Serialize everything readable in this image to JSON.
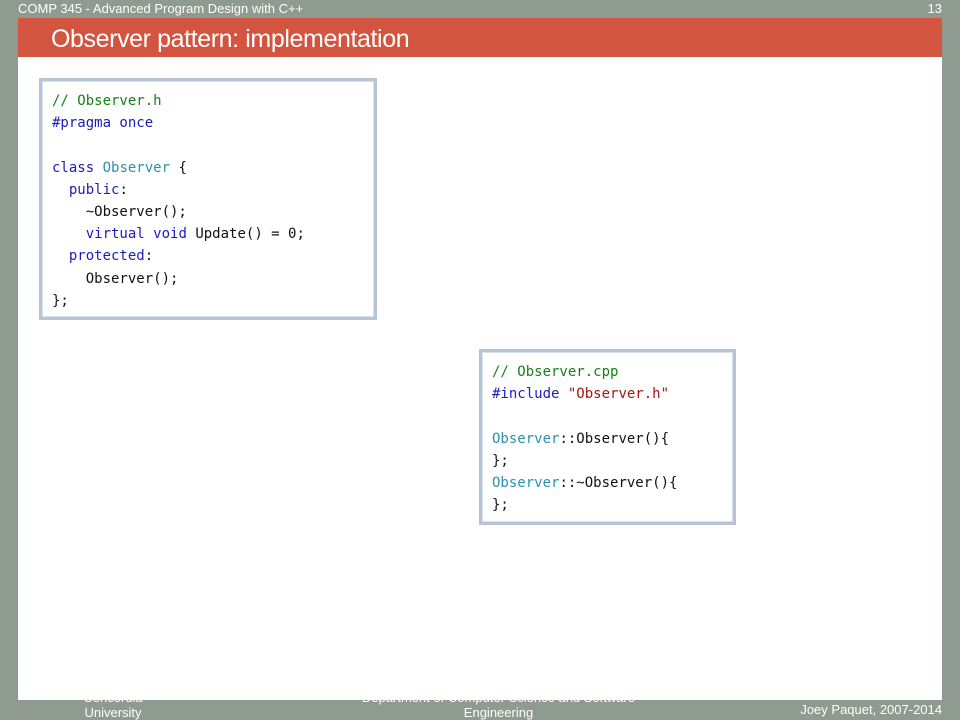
{
  "header": {
    "course": "COMP 345 - Advanced Program Design with C++",
    "page_number": "13"
  },
  "slide": {
    "title": "Observer pattern: implementation"
  },
  "code_blocks": [
    {
      "lines": [
        [
          {
            "text": "// Observer.h",
            "kind": "comment"
          }
        ],
        [
          {
            "text": "#pragma once",
            "kind": "keyword"
          }
        ],
        [],
        [
          {
            "text": "class",
            "kind": "keyword"
          },
          {
            "text": " ",
            "kind": "plain"
          },
          {
            "text": "Observer",
            "kind": "type"
          },
          {
            "text": " {",
            "kind": "plain"
          }
        ],
        [
          {
            "text": "  ",
            "kind": "plain"
          },
          {
            "text": "public",
            "kind": "keyword"
          },
          {
            "text": ":",
            "kind": "plain"
          }
        ],
        [
          {
            "text": "    ~Observer();",
            "kind": "plain"
          }
        ],
        [
          {
            "text": "    ",
            "kind": "plain"
          },
          {
            "text": "virtual",
            "kind": "keyword"
          },
          {
            "text": " ",
            "kind": "plain"
          },
          {
            "text": "void",
            "kind": "keyword"
          },
          {
            "text": " Update() = 0;",
            "kind": "plain"
          }
        ],
        [
          {
            "text": "  ",
            "kind": "plain"
          },
          {
            "text": "protected",
            "kind": "keyword"
          },
          {
            "text": ":",
            "kind": "plain"
          }
        ],
        [
          {
            "text": "    Observer();",
            "kind": "plain"
          }
        ],
        [
          {
            "text": "};",
            "kind": "plain"
          }
        ]
      ]
    },
    {
      "lines": [
        [
          {
            "text": "// Observer.cpp",
            "kind": "comment"
          }
        ],
        [
          {
            "text": "#include",
            "kind": "keyword"
          },
          {
            "text": " ",
            "kind": "plain"
          },
          {
            "text": "\"Observer.h\"",
            "kind": "string"
          }
        ],
        [],
        [
          {
            "text": "Observer",
            "kind": "type"
          },
          {
            "text": "::Observer(){",
            "kind": "plain"
          }
        ],
        [
          {
            "text": "};",
            "kind": "plain"
          }
        ],
        [
          {
            "text": "Observer",
            "kind": "type"
          },
          {
            "text": "::~Observer(){",
            "kind": "plain"
          }
        ],
        [
          {
            "text": "};",
            "kind": "plain"
          }
        ]
      ]
    }
  ],
  "footer": {
    "left": "Concordia\nUniversity",
    "middle": "Department of Computer Science and Software\nEngineering",
    "right": "Joey Paquet, 2007-2014"
  },
  "colors": {
    "background": "#8f9a90",
    "title_bar": "#d3553f",
    "slide": "#ffffff",
    "comment": "#178017",
    "keyword": "#1c1cb8",
    "type": "#2b91af",
    "string": "#a31515"
  }
}
